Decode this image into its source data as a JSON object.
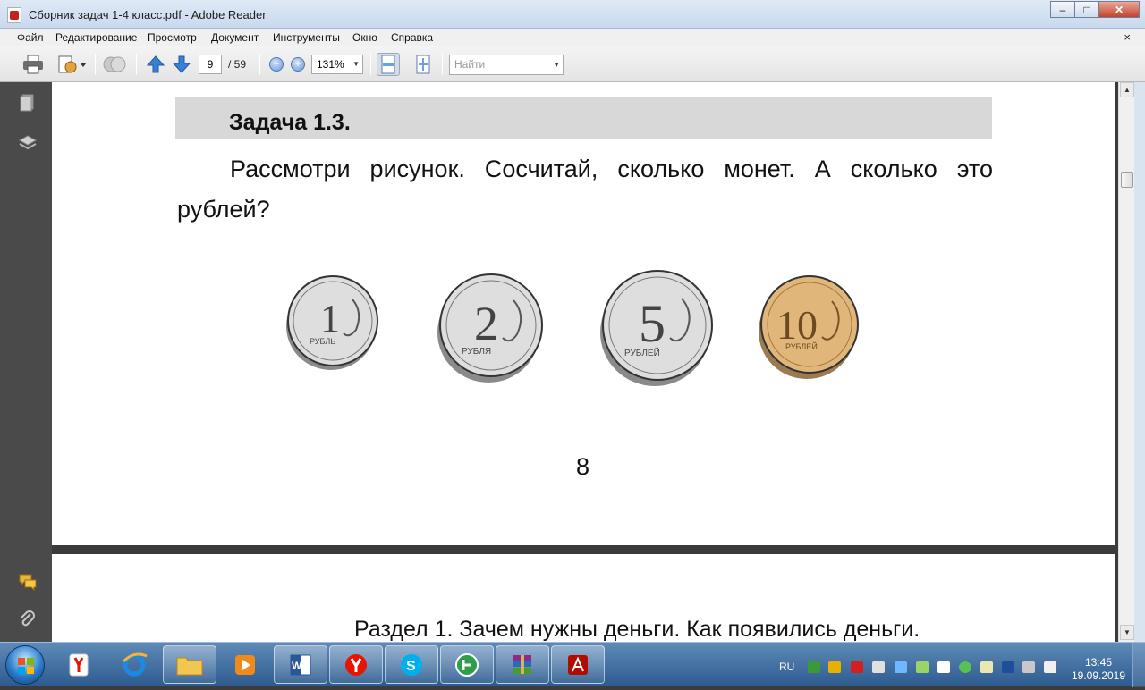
{
  "window": {
    "title": "Сборник  задач 1-4 класс.pdf - Adobe Reader",
    "minimize_label": "–",
    "maximize_label": "□",
    "close_label": "✕"
  },
  "menu": {
    "items": [
      "Файл",
      "Редактирование",
      "Просмотр",
      "Документ",
      "Инструменты",
      "Окно",
      "Справка"
    ],
    "doc_close": "×"
  },
  "toolbar": {
    "page_current": "9",
    "page_total": "/ 59",
    "zoom_value": "131%",
    "zoom_out_label": "−",
    "zoom_in_label": "+",
    "search_placeholder": "Найти"
  },
  "document": {
    "page1": {
      "heading": "Задача 1.3.",
      "body": "Рассмотри рисунок. Сосчитай, сколько монет. А сколько это рублей?",
      "coins": [
        {
          "numeral": "1",
          "word": "РУБЛЬ",
          "metal": "silver"
        },
        {
          "numeral": "2",
          "word": "РУБЛЯ",
          "metal": "silver"
        },
        {
          "numeral": "5",
          "word": "РУБЛЕЙ",
          "metal": "silver"
        },
        {
          "numeral": "10",
          "word": "РУБЛЕЙ",
          "metal": "gold"
        }
      ],
      "page_number": "8"
    },
    "page2": {
      "header_text": "Раздел 1. Зачем нужны деньги. Как появились деньги."
    }
  },
  "colors": {
    "titlebar": "#c9d9ee",
    "viewer_background": "#3b3b3b",
    "heading_bar": "#d8d8d8",
    "taskbar": "#2d5b8e"
  },
  "taskbar": {
    "language": "RU",
    "time": "13:45",
    "date": "19.09.2019",
    "apps": [
      "yandex-browser",
      "internet-explorer",
      "file-explorer",
      "media-player",
      "word",
      "yandex",
      "skype",
      "green-app",
      "winrar",
      "adobe-reader"
    ]
  }
}
